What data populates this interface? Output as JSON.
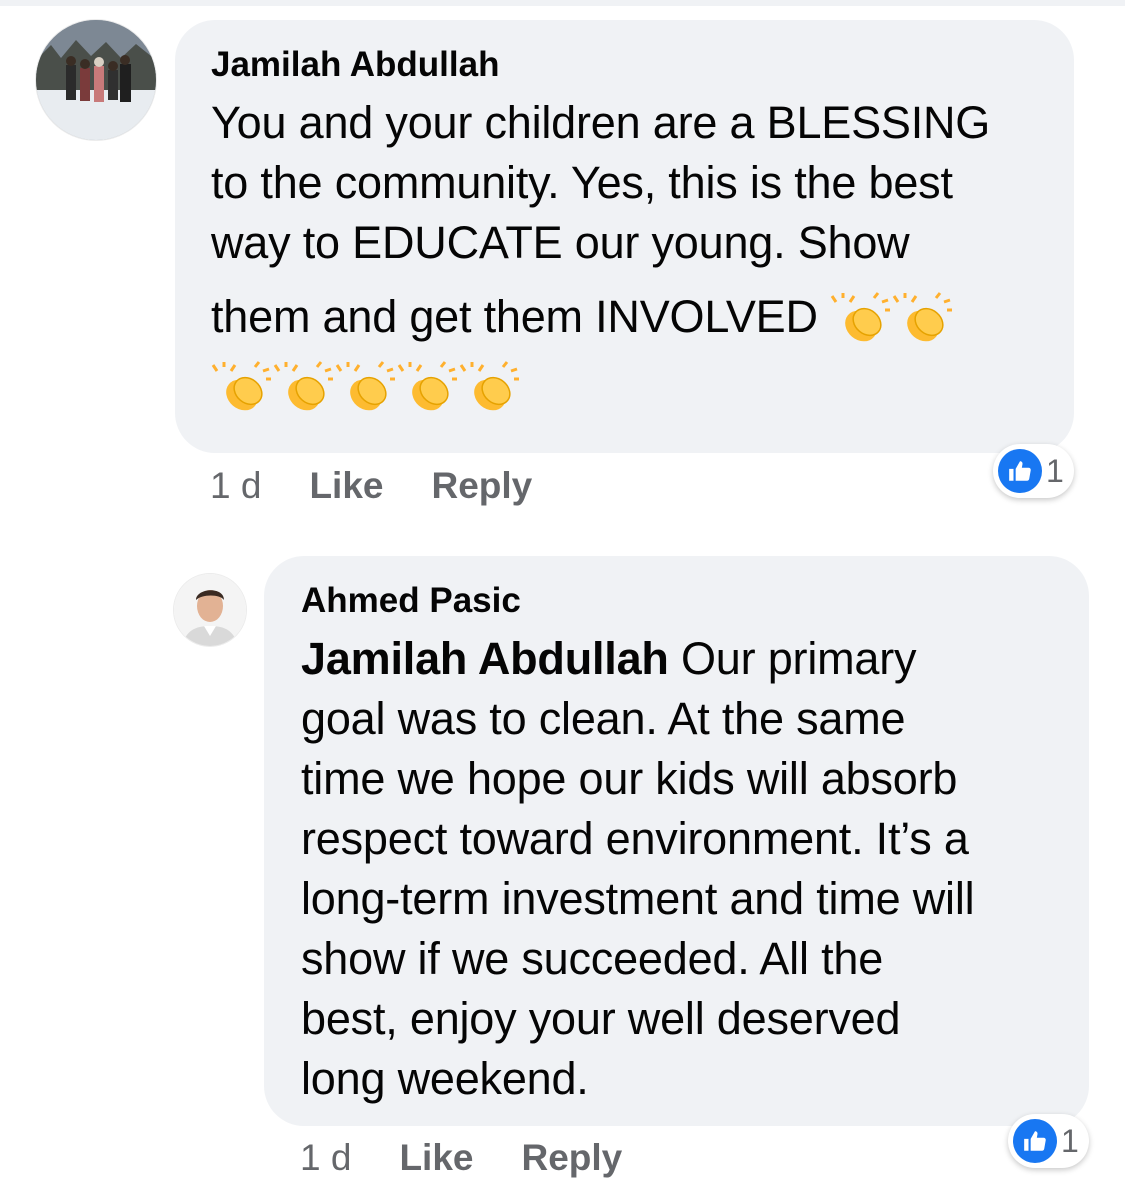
{
  "comments": [
    {
      "author": "Jamilah Abdullah",
      "text_lines": [
        "You and your children are a BLESSING",
        "to the community. Yes, this is the best",
        "way to EDUCATE our young. Show",
        "them and get them INVOLVED"
      ],
      "emoji": "clapping-hands",
      "time": "1 d",
      "like_label": "Like",
      "reply_label": "Reply",
      "reaction_count": "1"
    },
    {
      "author": "Ahmed Pasic",
      "mention": "Jamilah Abdullah",
      "text_lines": [
        " Our primary",
        "goal was to clean. At the same",
        "time we hope our kids will absorb",
        "respect toward environment. It’s a",
        "long-term investment and time will",
        "show if we succeeded. All the",
        "best, enjoy your well deserved",
        "long weekend."
      ],
      "time": "1 d",
      "like_label": "Like",
      "reply_label": "Reply",
      "reaction_count": "1"
    }
  ],
  "colors": {
    "bubble": "#f0f2f5",
    "meta": "#65676b",
    "like_blue": "#1877f2"
  }
}
